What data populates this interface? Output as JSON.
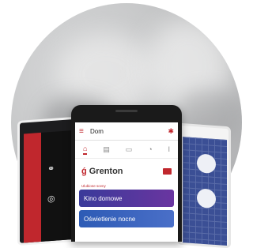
{
  "app": {
    "location": "Dom",
    "brand": "Grenton",
    "section_label": "Ulubione sceny",
    "scenes": [
      "Kino domowe",
      "Oświetlenie nocne"
    ],
    "tabs": [
      "home-icon",
      "blinds-icon",
      "sofa-icon",
      "lamp-icon",
      "thermometer-icon"
    ]
  },
  "colors": {
    "accent": "#c0272d",
    "card1": "#5a3aa0",
    "card2": "#3b62bb"
  }
}
